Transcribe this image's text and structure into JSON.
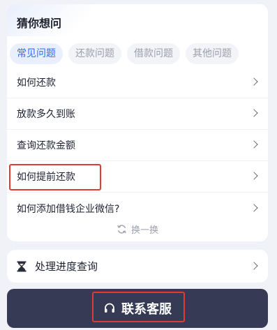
{
  "faq": {
    "title": "猜你想问",
    "tabs": [
      {
        "label": "常见问题",
        "active": true
      },
      {
        "label": "还款问题",
        "active": false
      },
      {
        "label": "借款问题",
        "active": false
      },
      {
        "label": "其他问题",
        "active": false
      }
    ],
    "questions": [
      {
        "label": "如何还款",
        "highlighted": false
      },
      {
        "label": "放款多久到账",
        "highlighted": false
      },
      {
        "label": "查询还款金额",
        "highlighted": false
      },
      {
        "label": "如何提前还款",
        "highlighted": true
      },
      {
        "label": "如何添加借钱企业微信?",
        "highlighted": false
      }
    ],
    "refresh_label": "换一换"
  },
  "progress": {
    "label": "处理进度查询",
    "icon": "hourglass-icon"
  },
  "contact": {
    "label": "联系客服",
    "icon": "headset-icon"
  },
  "colors": {
    "accent": "#2f6bff",
    "highlight_border": "#e33a36",
    "contact_bg": "#363a54",
    "page_bg": "#f1f2f7"
  }
}
